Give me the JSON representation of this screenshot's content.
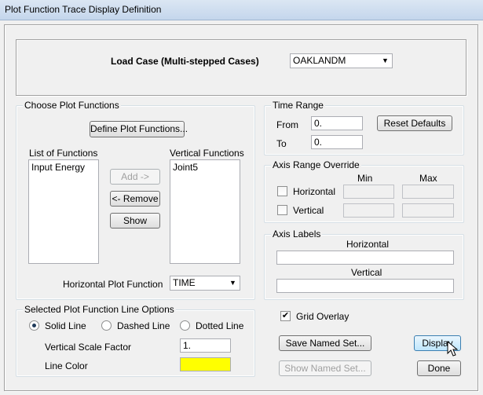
{
  "window": {
    "title": "Plot Function Trace Display Definition"
  },
  "load_case": {
    "label": "Load Case  (Multi-stepped Cases)",
    "value": "OAKLANDM"
  },
  "choose_plot_functions": {
    "group_title": "Choose Plot Functions",
    "define_button": "Define Plot Functions...",
    "list_of_functions_label": "List of Functions",
    "list_of_functions": [
      "Input Energy"
    ],
    "vertical_functions_label": "Vertical Functions",
    "vertical_functions": [
      "Joint5"
    ],
    "add_button": "Add ->",
    "remove_button": "<- Remove",
    "show_button": "Show",
    "horizontal_plot_function_label": "Horizontal Plot Function",
    "horizontal_plot_function_value": "TIME"
  },
  "time_range": {
    "group_title": "Time Range",
    "from_label": "From",
    "from_value": "0.",
    "to_label": "To",
    "to_value": "0.",
    "reset_button": "Reset Defaults"
  },
  "axis_range_override": {
    "group_title": "Axis Range Override",
    "min_label": "Min",
    "max_label": "Max",
    "horizontal_label": "Horizontal",
    "vertical_label": "Vertical"
  },
  "axis_labels": {
    "group_title": "Axis Labels",
    "horizontal_label": "Horizontal",
    "horizontal_value": "",
    "vertical_label": "Vertical",
    "vertical_value": ""
  },
  "line_options": {
    "group_title": "Selected Plot Function Line Options",
    "solid_label": "Solid Line",
    "dashed_label": "Dashed Line",
    "dotted_label": "Dotted Line",
    "scale_factor_label": "Vertical  Scale Factor",
    "scale_factor_value": "1.",
    "line_color_label": "Line Color",
    "line_color": "#ffff00"
  },
  "grid_overlay": {
    "label": "Grid Overlay",
    "checked": true
  },
  "buttons": {
    "save_named_set": "Save Named Set...",
    "show_named_set": "Show Named Set...",
    "display": "Display",
    "done": "Done"
  }
}
